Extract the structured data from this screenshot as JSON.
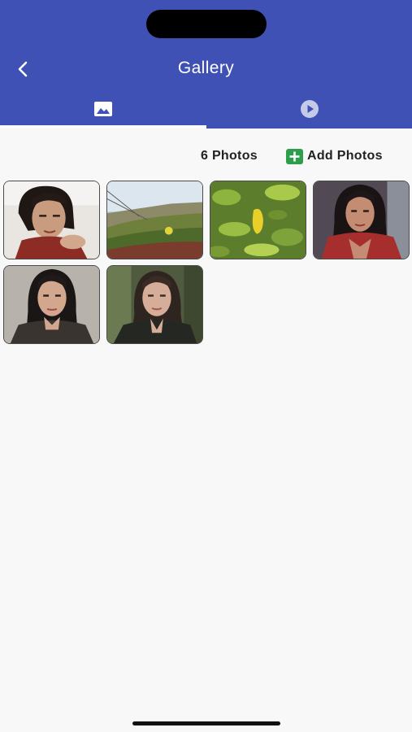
{
  "app": {
    "title": "Gallery",
    "accent_color": "#3f51b5",
    "add_icon_color": "#2e9e4c"
  },
  "tabs": [
    {
      "name": "photos",
      "icon": "image-icon",
      "selected": true
    },
    {
      "name": "videos",
      "icon": "play-circle-icon",
      "selected": false
    }
  ],
  "gallery": {
    "count_label": "6 Photos",
    "add_label": "Add Photos",
    "photos": [
      {
        "subject": "woman portrait, dark hair, red top, hand on chin"
      },
      {
        "subject": "coastal hillside with iceplant and fence"
      },
      {
        "subject": "green leaves with yellow lemon"
      },
      {
        "subject": "woman portrait, red jacket, dark background"
      },
      {
        "subject": "woman portrait, dark top, grey background"
      },
      {
        "subject": "woman portrait, dark blouse, green background"
      }
    ]
  }
}
